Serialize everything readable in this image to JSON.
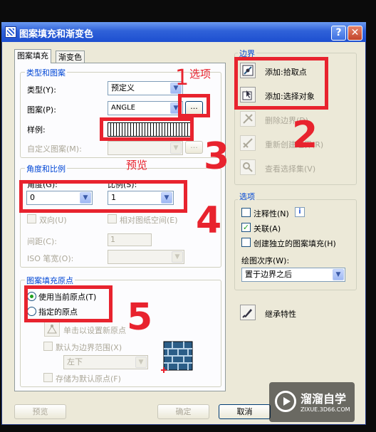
{
  "window": {
    "title": "图案填充和渐变色",
    "help": "?",
    "close": "✕"
  },
  "tabs": [
    {
      "label": "图案填充"
    },
    {
      "label": "渐变色"
    }
  ],
  "type_pattern": {
    "group_label": "类型和图案",
    "type_label": "类型(Y):",
    "type_value": "预定义",
    "pattern_label": "图案(P):",
    "pattern_value": "ANGLE",
    "pattern_browse": "...",
    "sample_label": "样例:",
    "custom_label": "自定义图案(M):",
    "custom_browse": "..."
  },
  "angle_scale": {
    "group_label": "角度和比例",
    "angle_label": "角度(G):",
    "angle_value": "0",
    "scale_label": "比例(S):",
    "scale_value": "1",
    "double_label": "双向(U)",
    "relative_label": "相对图纸空间(E)",
    "spacing_label": "间距(C):",
    "spacing_value": "1",
    "iso_label": "ISO 笔宽(O):"
  },
  "origin": {
    "group_label": "图案填充原点",
    "use_current": "使用当前原点(T)",
    "specified": "指定的原点",
    "click_set": "单击以设置新原点",
    "default_extents": "默认为边界范围(X)",
    "position_value": "左下",
    "store_default": "存储为默认原点(F)"
  },
  "boundaries": {
    "group_label": "边界",
    "add_pick": "添加:拾取点",
    "add_select": "添加:选择对象",
    "remove": "删除边界(D)",
    "recreate": "重新创建边界(R)",
    "view": "查看选择集(V)"
  },
  "options": {
    "group_label": "选项",
    "annotative": "注释性(N)",
    "associative": "关联(A)",
    "separate": "创建独立的图案填充(H)",
    "draw_order_label": "绘图次序(W):",
    "draw_order_value": "置于边界之后"
  },
  "inherit": {
    "label": "继承特性"
  },
  "buttons": {
    "preview": "预览",
    "ok": "确定",
    "cancel": "取消"
  },
  "annotations": {
    "label_options": "选项",
    "label_preview": "预览",
    "n1": "1",
    "n2": "2",
    "n3": "3",
    "n4": "4",
    "n5": "5"
  },
  "watermark": {
    "brand": "溜溜自学",
    "url": "ZIXUE.3D66.COM"
  },
  "colors": {
    "annotation": "#e8232e",
    "titlebar": "#2f61d8",
    "dialog": "#ece9d8"
  }
}
